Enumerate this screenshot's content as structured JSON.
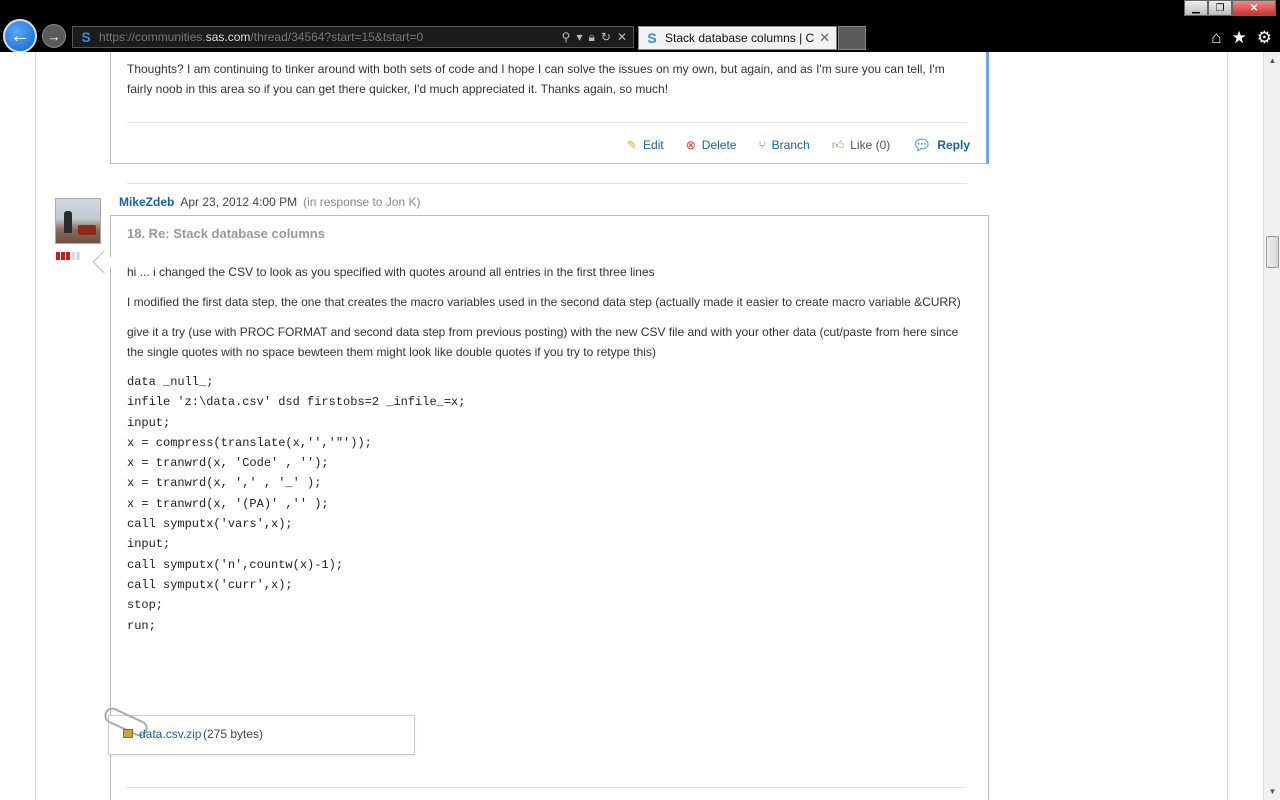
{
  "browser": {
    "url_prefix": "https://communities.",
    "url_domain": "sas.com",
    "url_suffix": "/thread/34564?start=15&tstart=0",
    "tab_title": "Stack database columns | C...",
    "tab_close": "✕",
    "site_icon": "S"
  },
  "previous_post": {
    "body": "Thoughts?  I am continuing to tinker around with both sets of code and I hope I can solve the issues on my own, but again, and as I'm sure you can tell, I'm fairly noob in this area so if you can get there quicker, I'd much appreciated it.  Thanks again, so much!",
    "actions": {
      "edit": "Edit",
      "delete": "Delete",
      "branch": "Branch",
      "like": "Like (0)",
      "reply": "Reply"
    }
  },
  "reply_post": {
    "author": "MikeZdeb",
    "date": "Apr 23, 2012 4:00 PM",
    "in_response": "(in response to Jon K)",
    "title": "18. Re: Stack database columns",
    "paragraphs": [
      "hi ... i changed the CSV to look as you specified with quotes around all entries in the first three lines",
      "I modified the first data step, the one that creates the macro variables used in the second data step (actually made it easier to create macro variable &CURR)",
      "give it a try (use with PROC FORMAT and second data step from previous posting) with the new CSV file and with your other data (cut/paste from here since the single quotes with no space bewteen them might look like double quotes if you try to retype this)"
    ],
    "code_lines": [
      "data _null_;",
      "infile 'z:\\data.csv' dsd firstobs=2 _infile_=x;",
      "input;",
      "x = compress(translate(x,'','\"'));",
      "x = tranwrd(x, 'Code' , '');",
      "x = tranwrd(x, ',' , '_' );",
      "x = tranwrd(x, '(PA)' ,'' );",
      "call symputx('vars',x);",
      "input;",
      "call symputx('n',countw(x)-1);",
      "call symputx('curr',x);",
      "stop;",
      "run;"
    ],
    "attachment": {
      "name": "data.csv.zip",
      "size": "(275 bytes)"
    }
  },
  "colors": {
    "link": "#1a5fa8",
    "accent_border": "#6fa7de",
    "rank": "#c41e1e"
  }
}
